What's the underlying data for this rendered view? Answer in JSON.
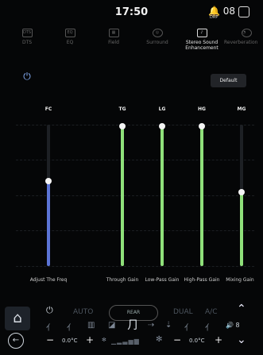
{
  "status": {
    "time": "17:50",
    "notification_count": "08",
    "notification_sub": "DRP"
  },
  "tabs": [
    {
      "label": "DTS",
      "icon": "DTS"
    },
    {
      "label": "EQ",
      "icon": "EQ"
    },
    {
      "label": "Field",
      "icon": "▦"
    },
    {
      "label": "Surround",
      "icon": "◎"
    },
    {
      "label": "Stereo Sound Enhancement",
      "icon": "♪"
    },
    {
      "label": "Reverberation",
      "icon": "◔"
    }
  ],
  "default_label": "Default",
  "channels": [
    {
      "label": "FC",
      "bottom_label": "Adjust The Freq",
      "value": 0.6,
      "color": "#5b74d6"
    },
    {
      "label": "TG",
      "bottom_label": "Through Gain",
      "value": 0.99,
      "color": "#8fe07a"
    },
    {
      "label": "LG",
      "bottom_label": "Low-Pass Gain",
      "value": 0.99,
      "color": "#8fe07a"
    },
    {
      "label": "HG",
      "bottom_label": "High-Pass Gain",
      "value": 0.99,
      "color": "#8fe07a"
    },
    {
      "label": "MG",
      "bottom_label": "Mixing Gain",
      "value": 0.52,
      "color": "#8fe07a"
    }
  ],
  "climate": {
    "auto": "AUTO",
    "rear": "REAR",
    "dual": "DUAL",
    "ac": "A/C",
    "left_temp": "0.0°C",
    "right_temp": "0.0°C",
    "fan_speed": "8"
  }
}
